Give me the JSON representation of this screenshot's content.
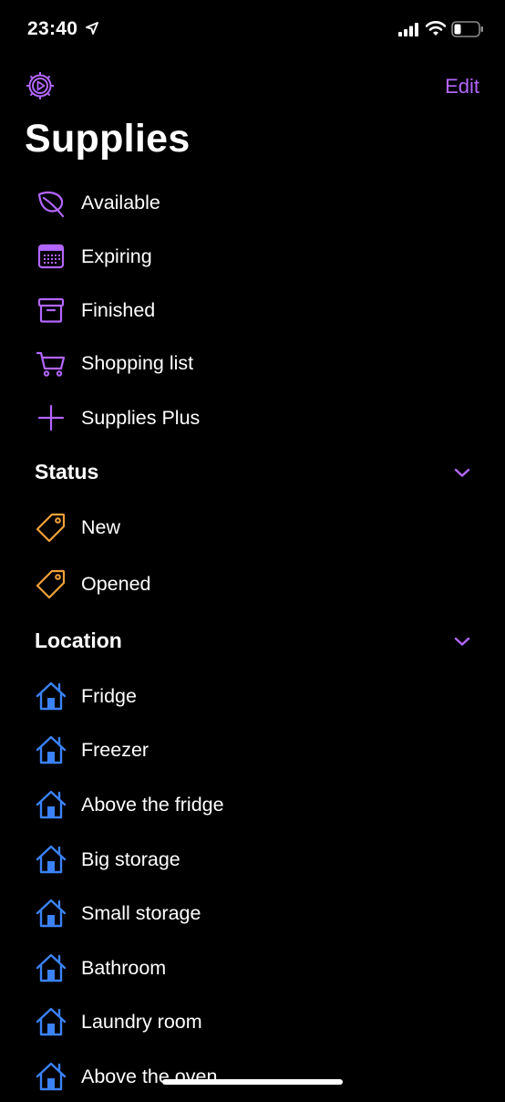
{
  "status_bar": {
    "time": "23:40"
  },
  "header": {
    "edit_label": "Edit",
    "title": "Supplies"
  },
  "colors": {
    "accent": "#b366ff",
    "tag": "#f0a23a",
    "home": "#3b82f6"
  },
  "main_items": [
    {
      "label": "Available",
      "icon": "leaf-icon"
    },
    {
      "label": "Expiring",
      "icon": "calendar-icon"
    },
    {
      "label": "Finished",
      "icon": "archive-box-icon"
    },
    {
      "label": "Shopping list",
      "icon": "cart-icon"
    },
    {
      "label": "Supplies Plus",
      "icon": "plus-icon"
    }
  ],
  "status_section": {
    "title": "Status",
    "items": [
      {
        "label": "New",
        "icon": "tag-icon"
      },
      {
        "label": "Opened",
        "icon": "tag-icon"
      }
    ]
  },
  "location_section": {
    "title": "Location",
    "items": [
      {
        "label": "Fridge",
        "icon": "house-icon"
      },
      {
        "label": "Freezer",
        "icon": "house-icon"
      },
      {
        "label": "Above the fridge",
        "icon": "house-icon"
      },
      {
        "label": "Big storage",
        "icon": "house-icon"
      },
      {
        "label": "Small storage",
        "icon": "house-icon"
      },
      {
        "label": "Bathroom",
        "icon": "house-icon"
      },
      {
        "label": "Laundry room",
        "icon": "house-icon"
      },
      {
        "label": "Above the oven",
        "icon": "house-icon"
      }
    ]
  }
}
